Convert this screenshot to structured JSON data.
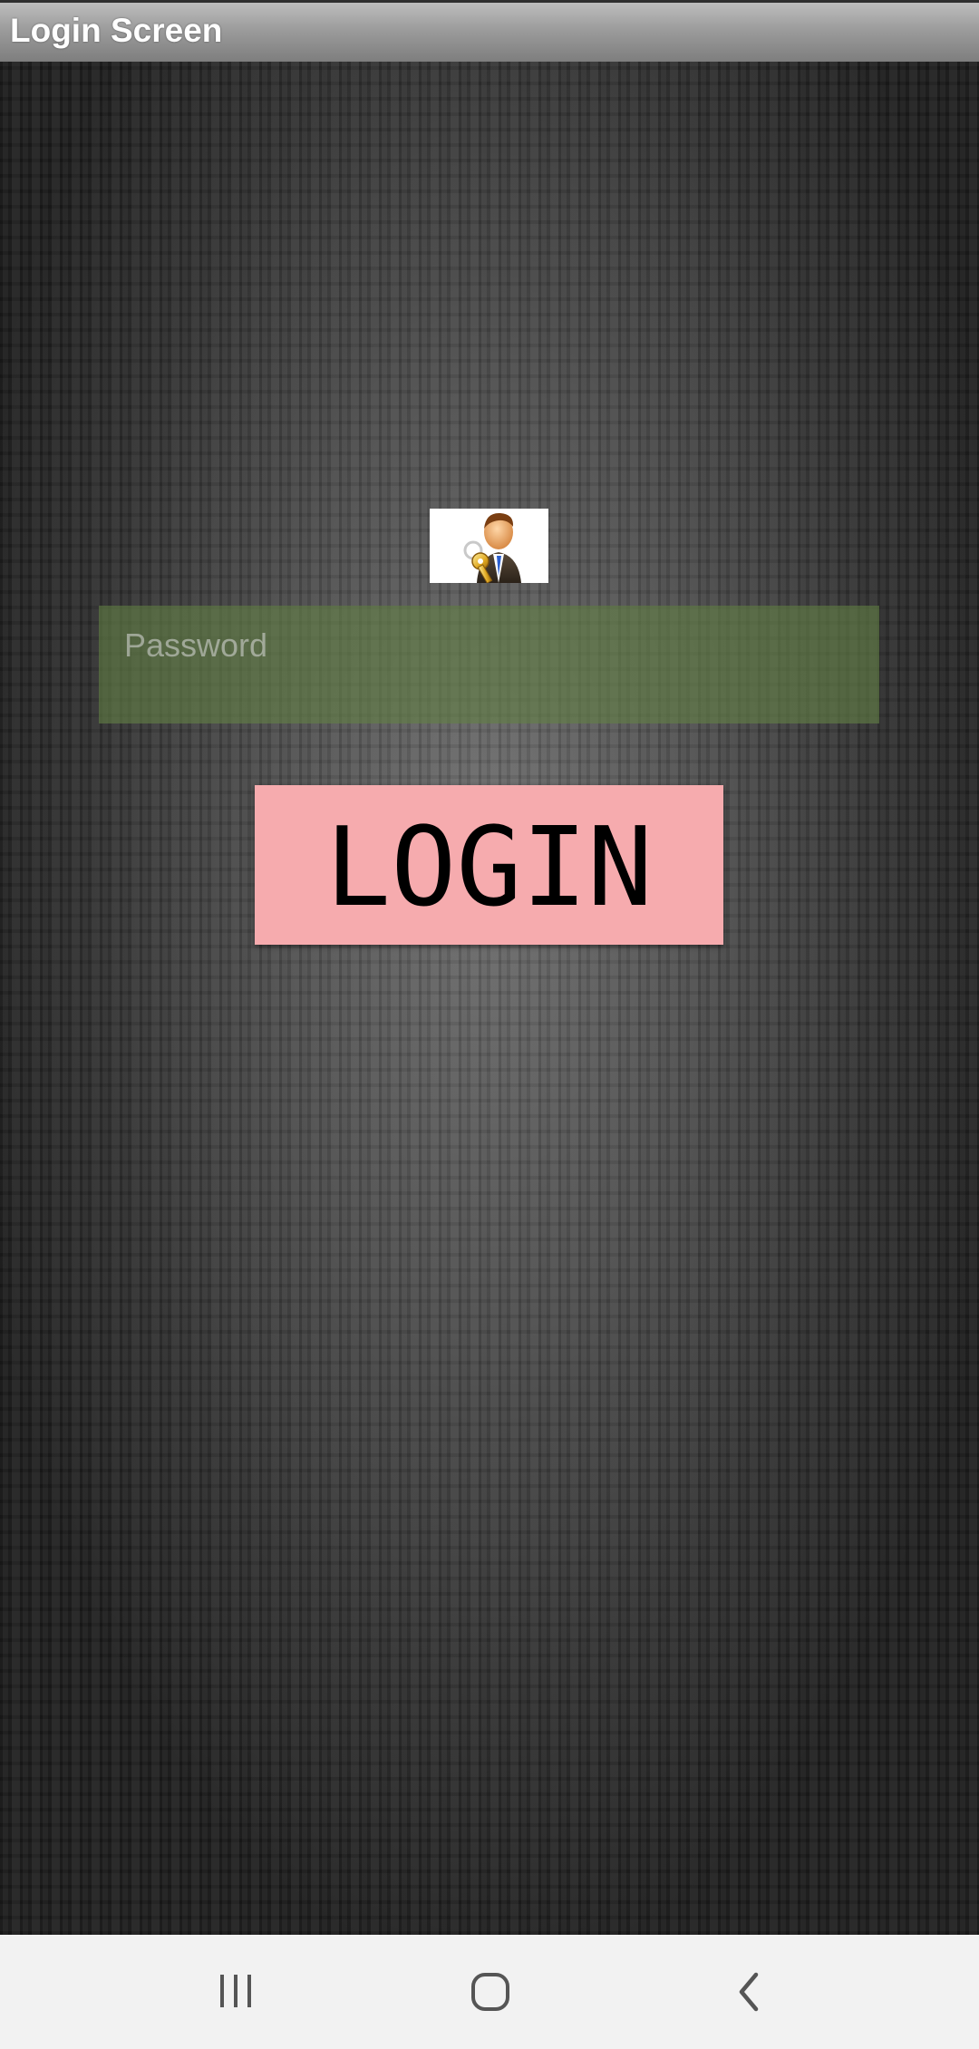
{
  "app": {
    "title": "Login Screen"
  },
  "login_form": {
    "password_placeholder": "Password",
    "password_value": "",
    "login_label": "LOGIN",
    "avatar_icon": "user-with-key-icon"
  },
  "nav_bar": {
    "recents_icon": "recents-icon",
    "home_icon": "home-icon",
    "back_icon": "back-icon"
  },
  "colors": {
    "title_bar": "#9c9c9c",
    "password_field": "#628046",
    "login_button": "#f6abae",
    "nav_bar": "#f2f2f2"
  }
}
